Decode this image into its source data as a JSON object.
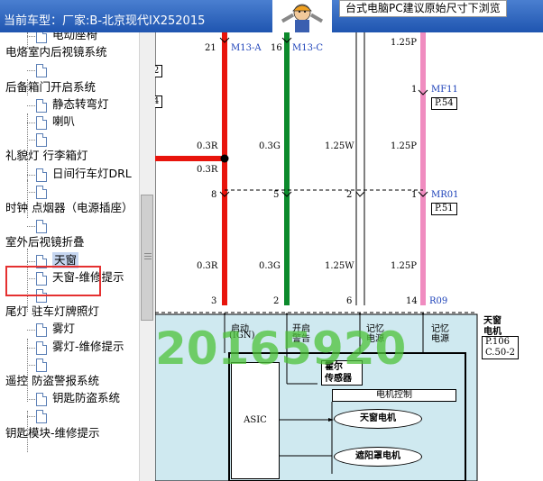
{
  "titlebar": {
    "prefix": "当前车型：",
    "vehicle": "厂家:B-北京现代IX252015",
    "notice": "台式电脑PC建议原始尺寸下浏览"
  },
  "tree": {
    "items": [
      {
        "label": "电动座椅",
        "level": 2
      },
      {
        "label": "电烙室内后视镜系统",
        "level": 1
      },
      {
        "label": "",
        "level": 2
      },
      {
        "label": "后备箱门开启系统",
        "level": 1
      },
      {
        "label": "静态转弯灯",
        "level": 2
      },
      {
        "label": "喇叭",
        "level": 2
      },
      {
        "label": "",
        "level": 2
      },
      {
        "label": "礼貌灯 行李箱灯",
        "level": 1
      },
      {
        "label": "日间行车灯DRL",
        "level": 2
      },
      {
        "label": "",
        "level": 2
      },
      {
        "label": "时钟 点烟器（电源插座）",
        "level": 1
      },
      {
        "label": "",
        "level": 2
      },
      {
        "label": "室外后视镜折叠",
        "level": 1
      },
      {
        "label": "天窗",
        "level": 2,
        "selected": true
      },
      {
        "label": "天窗-维修提示",
        "level": 2
      },
      {
        "label": "",
        "level": 2
      },
      {
        "label": "尾灯 驻车灯牌照灯",
        "level": 1
      },
      {
        "label": "雾灯",
        "level": 2
      },
      {
        "label": "雾灯-维修提示",
        "level": 2
      },
      {
        "label": "",
        "level": 2
      },
      {
        "label": "遥控 防盗警报系统",
        "level": 1
      },
      {
        "label": "钥匙防盗系统",
        "level": 2
      },
      {
        "label": "",
        "level": 2
      },
      {
        "label": "钥匙模块-维修提示",
        "level": 1
      }
    ]
  },
  "diagram": {
    "pins_top": [
      "21",
      "16"
    ],
    "connectors_top": [
      "M13-A",
      "M13-C"
    ],
    "wire_pink_top": "1.25P",
    "mf11": {
      "pin": "1",
      "name": "MF11",
      "page": "P.54"
    },
    "left_boxes": [
      "2",
      "4"
    ],
    "wires_row1": [
      "0.3R",
      "0.3G",
      "1.25W",
      "1.25P"
    ],
    "wire_branch": "0.3R",
    "pins_mid": [
      "8",
      "5",
      "2",
      "1"
    ],
    "mr01": {
      "name": "MR01",
      "page": "P.51"
    },
    "wires_row2": [
      "0.3R",
      "0.3G",
      "1.25W",
      "1.25P"
    ],
    "pins_bottom": [
      "3",
      "2",
      "6",
      "14"
    ],
    "r09": "R09",
    "module_title": [
      "天窗",
      "电机"
    ],
    "module_pages": [
      "P.106",
      "C.50-2"
    ],
    "inputs": [
      {
        "line1": "启动",
        "line2": "(IGN)"
      },
      {
        "line1": "开启",
        "line2": "警告"
      },
      {
        "line1": "记忆",
        "line2": "电源"
      },
      {
        "line1": "记忆",
        "line2": "电源"
      }
    ],
    "hall_sensor": [
      "霍尔",
      "传感器"
    ],
    "motor_control": "电机控制",
    "asic": "ASIC",
    "sunroof_motor": "天窗电机",
    "shade_motor": "遮阳罩电机",
    "watermark": "20165920"
  },
  "colors": {
    "wire_red": "#e8140c",
    "wire_green": "#0c8a2c",
    "wire_pink": "#f08cc0",
    "module_fill": "#cfe9f0",
    "titlebar": "#2a62c0",
    "selection_box": "#e53030"
  }
}
